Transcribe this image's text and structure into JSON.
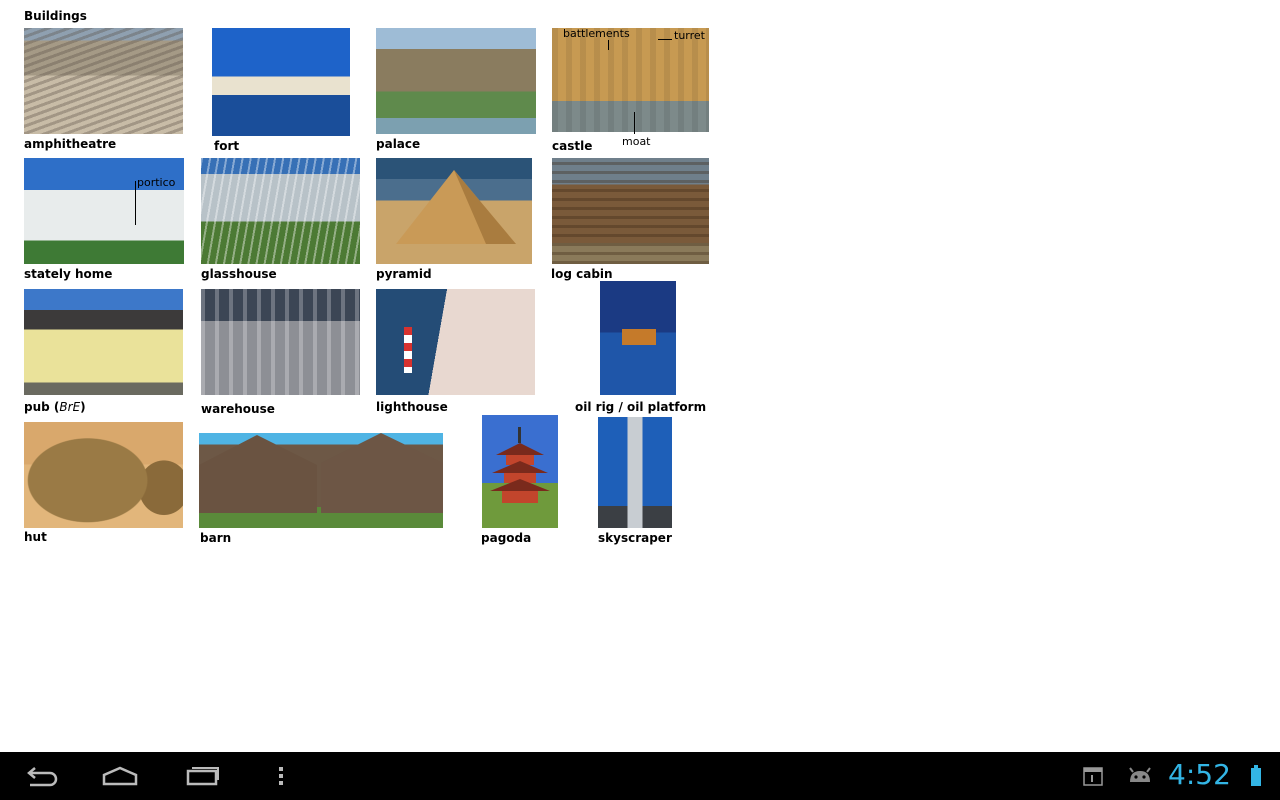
{
  "title": "Buildings",
  "items": {
    "amphitheatre": "amphitheatre",
    "fort": "fort",
    "palace": "palace",
    "castle": "castle",
    "stately_home": "stately home",
    "glasshouse": "glasshouse",
    "pyramid": "pyramid",
    "log_cabin": "log cabin",
    "pub": "pub",
    "pub_note": "BrE",
    "warehouse": "warehouse",
    "lighthouse": "lighthouse",
    "oil_rig": "oil rig / oil platform",
    "hut": "hut",
    "barn": "barn",
    "pagoda": "pagoda",
    "skyscraper": "skyscraper"
  },
  "annotations": {
    "battlements": "battlements",
    "turret": "turret",
    "moat": "moat",
    "portico": "portico"
  },
  "status_bar": {
    "time": "4:52",
    "accent_color": "#33b5e5"
  },
  "icons": [
    "back-icon",
    "home-icon",
    "recent-apps-icon",
    "menu-overflow-icon",
    "calendar-icon",
    "android-icon",
    "battery-icon"
  ]
}
